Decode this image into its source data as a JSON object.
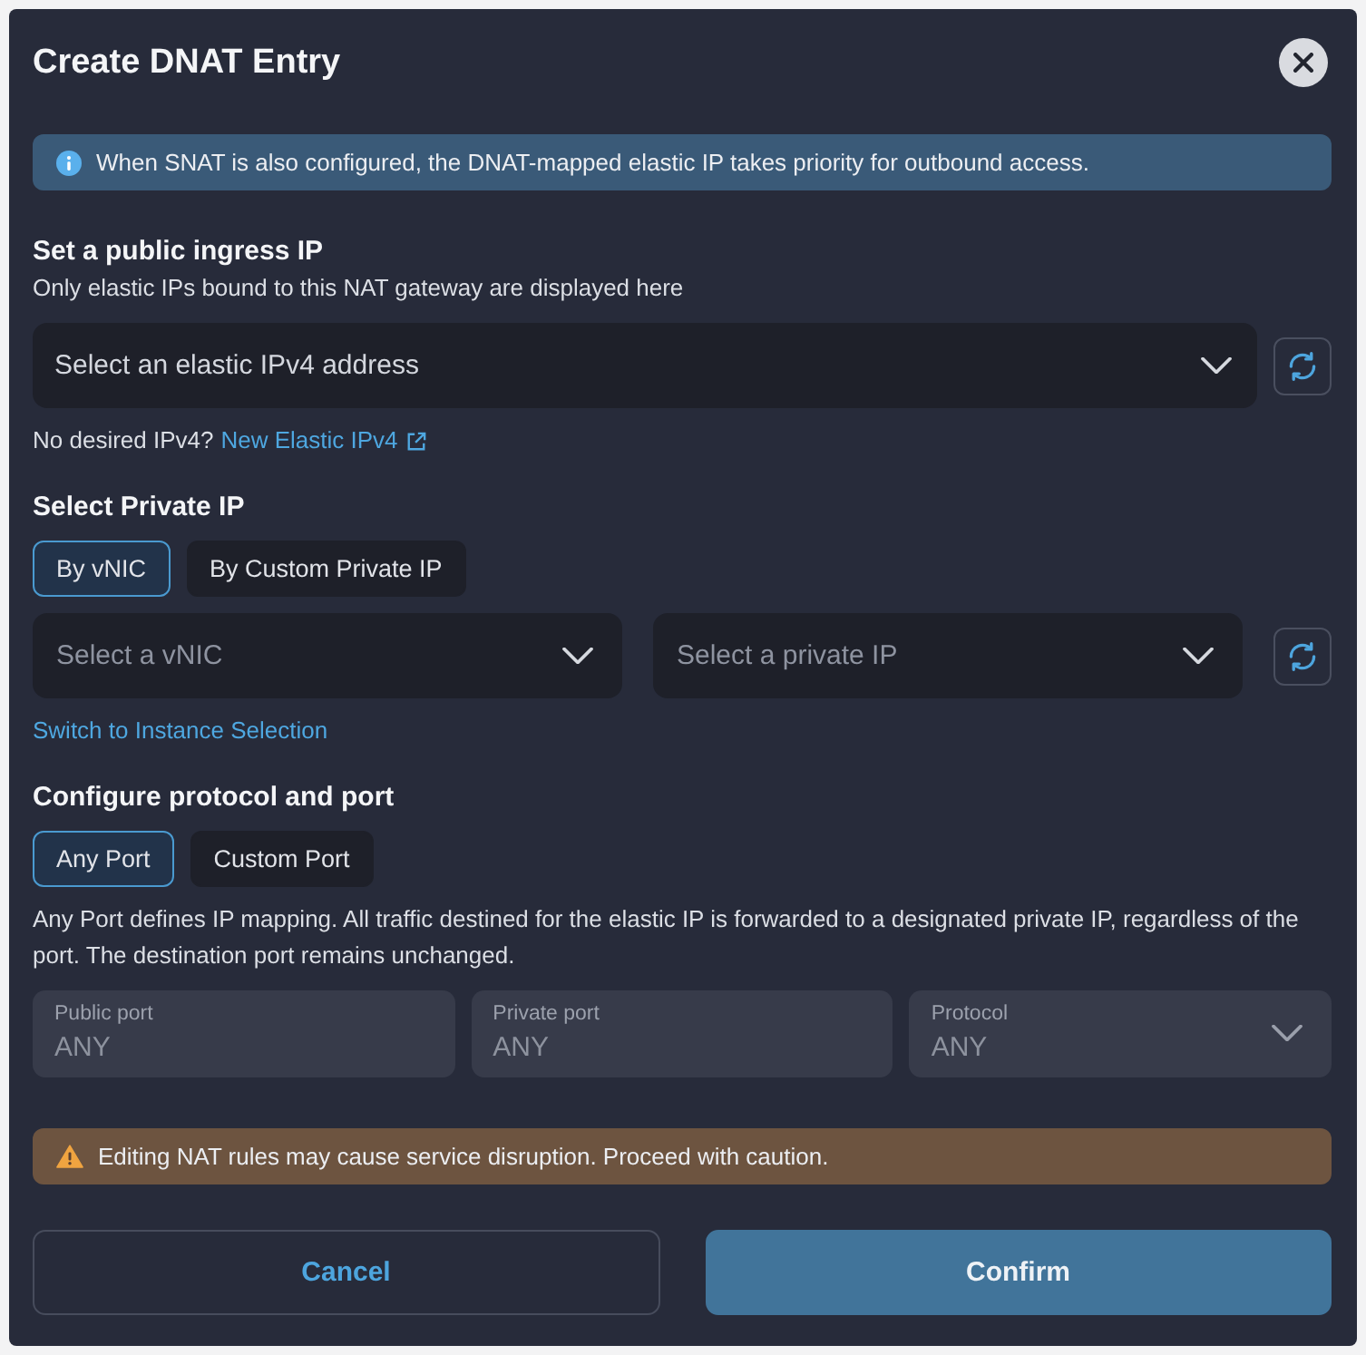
{
  "dialog": {
    "title": "Create DNAT Entry"
  },
  "info_banner": {
    "kind": "info",
    "text": "When SNAT is also configured, the DNAT-mapped elastic IP takes priority for outbound access."
  },
  "public_ip": {
    "heading": "Set a public ingress IP",
    "description": "Only elastic IPs bound to this NAT gateway are displayed here",
    "select": {
      "placeholder": "Select an elastic IPv4 address"
    },
    "hint": "No desired IPv4?",
    "link": "New Elastic IPv4"
  },
  "private_ip": {
    "heading": "Select Private IP",
    "tabs": [
      {
        "label": "By vNIC",
        "selected": true
      },
      {
        "label": "By Custom Private IP",
        "selected": false
      }
    ],
    "selects": [
      {
        "placeholder": "Select a vNIC"
      },
      {
        "placeholder": "Select a private IP"
      }
    ],
    "link": "Switch to Instance Selection"
  },
  "protocol_port": {
    "heading": "Configure protocol and port",
    "tabs": [
      {
        "label": "Any Port",
        "selected": true
      },
      {
        "label": "Custom Port",
        "selected": false
      }
    ],
    "description": "Any Port defines IP mapping. All traffic destined for the elastic IP is forwarded to a designated private IP, regardless of the port. The destination port remains unchanged.",
    "fields": [
      {
        "kind": "text",
        "label": "Public port",
        "value": "ANY",
        "disabled": true
      },
      {
        "kind": "text",
        "label": "Private port",
        "value": "ANY",
        "disabled": true
      },
      {
        "kind": "select",
        "label": "Protocol",
        "value": "ANY",
        "disabled": true
      }
    ]
  },
  "warning_banner": {
    "kind": "warning",
    "text": "Editing NAT rules may cause service disruption. Proceed with caution."
  },
  "buttons": [
    {
      "kind": "secondary",
      "label": "Cancel"
    },
    {
      "kind": "primary",
      "label": "Confirm"
    }
  ]
}
